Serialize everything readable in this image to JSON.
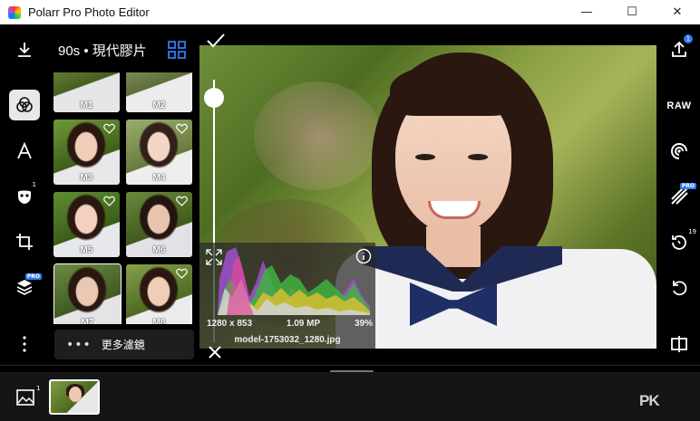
{
  "window": {
    "title": "Polarr Pro Photo Editor",
    "minimize": "—",
    "maximize": "☐",
    "close": "✕"
  },
  "left_toolbar": {
    "effects_badge": "1",
    "layers_badge": "PRO"
  },
  "filter_panel": {
    "title": "90s • 現代膠片",
    "more_dots": "•••",
    "more_label": "更多濾鏡",
    "filters": [
      {
        "label": "M1",
        "favorite": false
      },
      {
        "label": "M2",
        "favorite": false
      },
      {
        "label": "M3",
        "favorite": false
      },
      {
        "label": "M4",
        "favorite": false
      },
      {
        "label": "M5",
        "favorite": false
      },
      {
        "label": "M6",
        "favorite": false
      },
      {
        "label": "M7",
        "favorite": false,
        "selected": true
      },
      {
        "label": "M8",
        "favorite": false
      }
    ]
  },
  "canvas": {
    "filter_strength": 0.93,
    "histogram": {
      "resolution": "1280 x 853",
      "megapixels": "1.09 MP",
      "zoom": "39%",
      "filename": "model-1753032_1280.jpg"
    }
  },
  "right_toolbar": {
    "upload_badge": "1",
    "raw_label": "RAW",
    "pro_badge": "PRO",
    "history_count": "19"
  },
  "bottom_bar": {
    "gallery_badge": "1",
    "watermark": "PK"
  },
  "colors": {
    "accent": "#2f7cf6",
    "titlebar": "#ffffff",
    "background": "#000000"
  }
}
